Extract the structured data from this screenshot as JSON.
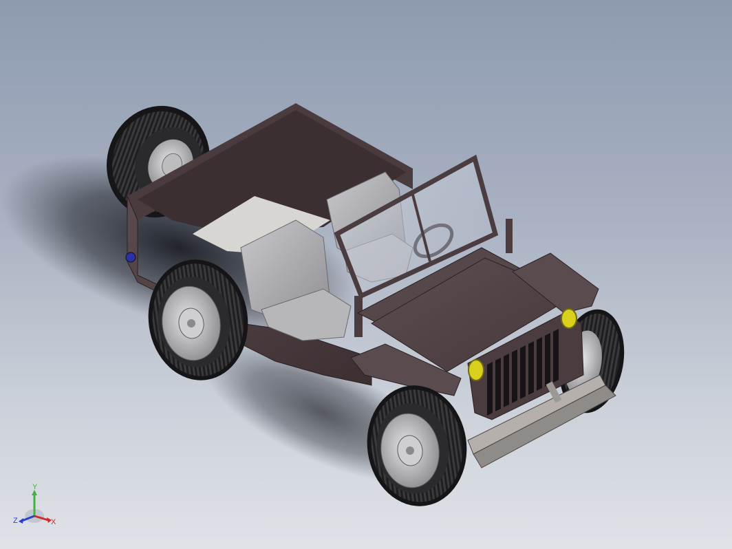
{
  "viewport": {
    "model": "jeep-assembly",
    "background_top": "#8d9ab0",
    "background_bottom": "#dfe2e7",
    "body_color": "#4f4043",
    "seat_color": "#a9a9ad",
    "headlight_color": "#d8d01c",
    "tail_light_color": "#2b2fa8"
  },
  "triad": {
    "y_label": "Y",
    "x_label": "X",
    "z_label": "Z",
    "y_color": "#3fb33f",
    "x_color": "#d02a2a",
    "z_color": "#2a3fd0"
  }
}
